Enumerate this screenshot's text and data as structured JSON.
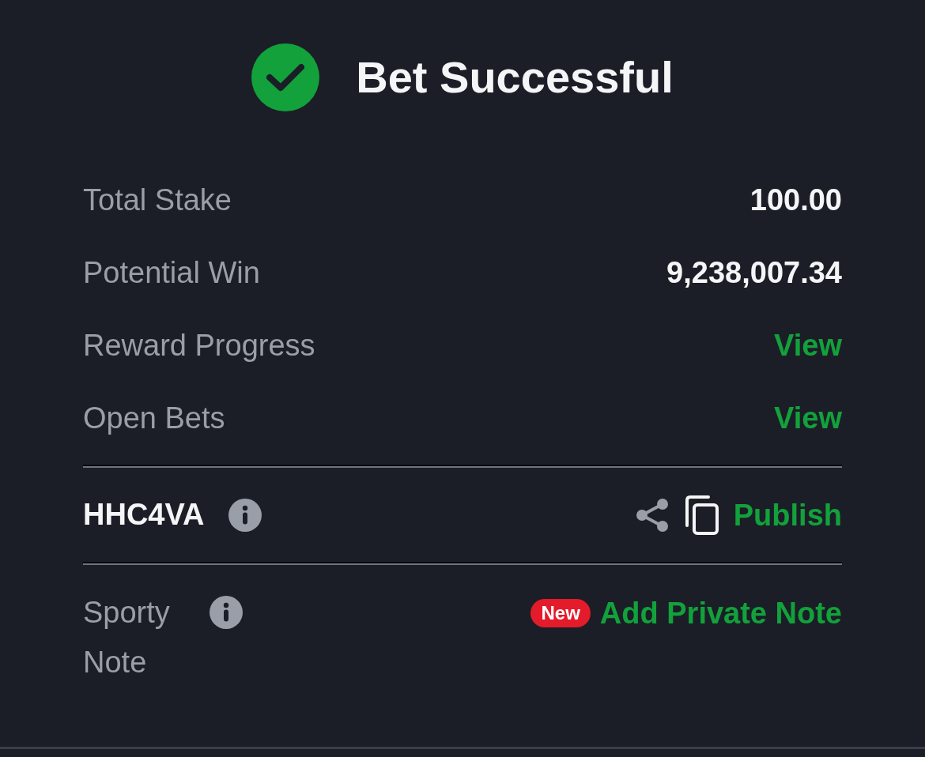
{
  "header": {
    "title": "Bet Successful"
  },
  "summary": [
    {
      "label": "Total Stake",
      "value": "100.00",
      "kind": "amount"
    },
    {
      "label": "Potential Win",
      "value": "9,238,007.34",
      "kind": "amount"
    },
    {
      "label": "Reward Progress",
      "value": "View",
      "kind": "link"
    },
    {
      "label": "Open Bets",
      "value": "View",
      "kind": "link"
    }
  ],
  "booking": {
    "code": "HHC4VA",
    "action": "Publish"
  },
  "note": {
    "label": "Sporty Note",
    "badge": "New",
    "action": "Add Private Note"
  }
}
